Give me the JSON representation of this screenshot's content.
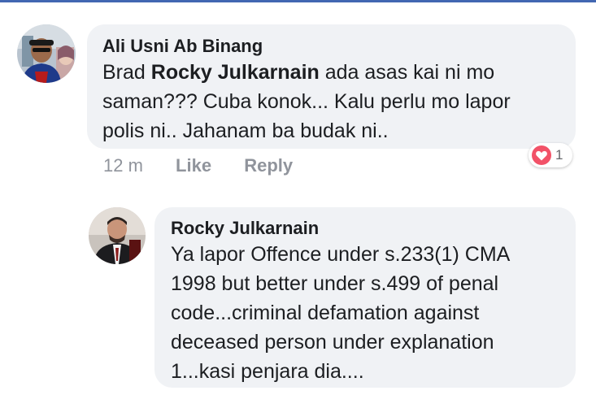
{
  "colors": {
    "accent_bar": "#4267b2",
    "bubble_bg": "#f0f2f5",
    "text": "#1c1e21",
    "meta_text": "#90949c",
    "love_reaction": "#f25268"
  },
  "comment": {
    "author": "Ali Usni Ab Binang",
    "text_line1_prefix": "Brad ",
    "mention": "Rocky Julkarnain",
    "text_line1_suffix": " ada asas kai ni mo",
    "text_line2": "saman??? Cuba konok... Kalu perlu mo lapor",
    "text_line3": "polis ni.. Jahanam ba budak ni..",
    "timestamp": "12 m",
    "like_label": "Like",
    "reply_label": "Reply",
    "reaction_icon": "heart-icon",
    "reaction_count": "1"
  },
  "reply": {
    "author": "Rocky Julkarnain",
    "lines": [
      "Ya lapor Offence under s.233(1) CMA",
      "1998 but better under s.499 of penal",
      "code...criminal defamation against",
      "deceased person under explanation",
      "1...kasi penjara dia...."
    ]
  }
}
